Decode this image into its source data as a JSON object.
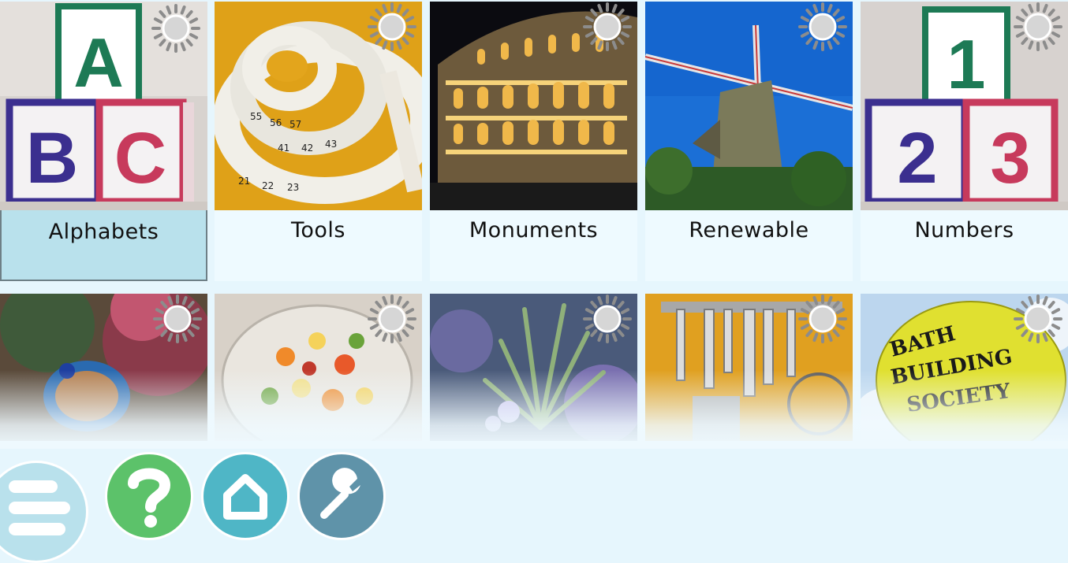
{
  "categories": [
    {
      "label": "Alphabets",
      "selected": true
    },
    {
      "label": "Tools",
      "selected": false
    },
    {
      "label": "Monuments",
      "selected": false
    },
    {
      "label": "Renewable",
      "selected": false
    },
    {
      "label": "Numbers",
      "selected": false
    }
  ],
  "second_row": [
    "fish",
    "fruit-salad",
    "rosemary",
    "kitchen-utensils",
    "hot-air-balloon"
  ],
  "balloon_text": {
    "line1": "BATH",
    "line2": "BUILDING",
    "line3": "SOCIETY"
  },
  "toolbar": {
    "help_icon": "question-mark-icon",
    "home_icon": "home-icon",
    "settings_icon": "wrench-icon"
  },
  "colors": {
    "selected_card": "#b9e1ec",
    "card": "#eefaff",
    "help": "#5cc26a",
    "home": "#4fb6c6",
    "settings": "#5f93a9"
  }
}
